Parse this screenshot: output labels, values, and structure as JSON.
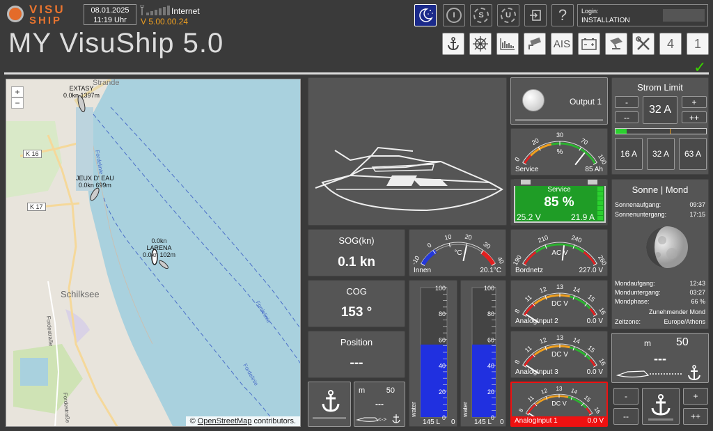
{
  "header": {
    "logo_top": "VISU",
    "logo_bottom": "SHIP",
    "date": "08.01.2025",
    "time": "11:19 Uhr",
    "network_label": "Internet",
    "version": "V 5.00.00.24",
    "title": "MY VisuShip 5.0",
    "login_label": "Login:",
    "login_value": "INSTALLATION"
  },
  "toolbar_top": [
    {
      "name": "night-mode-button",
      "icon": "moon-icon"
    },
    {
      "name": "info-button",
      "label": "I"
    },
    {
      "name": "settings-s-button",
      "label": "S"
    },
    {
      "name": "user-button",
      "label": "U"
    },
    {
      "name": "logout-button",
      "icon": "exit-icon"
    },
    {
      "name": "help-button",
      "label": "?"
    }
  ],
  "toolbar_bottom": [
    {
      "name": "anchor-tab",
      "icon": "anchor-icon"
    },
    {
      "name": "helm-tab",
      "icon": "helm-icon"
    },
    {
      "name": "chart-tab",
      "icon": "chart-icon"
    },
    {
      "name": "camera-tab",
      "icon": "camera-icon"
    },
    {
      "name": "ais-tab",
      "label": "AIS"
    },
    {
      "name": "battery-tab",
      "icon": "battery-icon"
    },
    {
      "name": "satellite-tab",
      "icon": "satellite-icon"
    },
    {
      "name": "tools-tab",
      "icon": "tools-icon"
    },
    {
      "name": "page-4-tab",
      "label": "4"
    },
    {
      "name": "page-1-tab",
      "label": "1"
    }
  ],
  "map": {
    "credit_prefix": "©",
    "credit_link": "OpenStreetMap",
    "credit_suffix": "contributors.",
    "zoom_in": "+",
    "zoom_out": "−",
    "labels": {
      "strande": "Strande",
      "schilksee": "Schilksee",
      "k16": "K 16",
      "k17": "K 17",
      "fordelinie1": "Fordelinie",
      "fordelinie2": "Fordelinie",
      "fordelinie3": "Fordelinie",
      "fordestrasse": "Fordestraße",
      "fordestrasse2": "Fordestraße"
    },
    "ships": [
      {
        "name": "EXTASY",
        "info": "0.0kn 1397m"
      },
      {
        "name": "JEUX D' EAU",
        "info": "0.0kn 699m"
      },
      {
        "name": "LARENA",
        "info_top": "0.0kn",
        "info": "0.0kn 102m"
      }
    ]
  },
  "nav": {
    "sog_label": "SOG(kn)",
    "sog_value": "0.1 kn",
    "cog_label": "COG",
    "cog_value": "153 °",
    "pos_label": "Position",
    "pos_value": "---"
  },
  "anchor_small": {
    "unit": "m",
    "value": "50",
    "dash": "---"
  },
  "temp_gauge": {
    "ticks": [
      "-10",
      "0",
      "10",
      "20",
      "30",
      "40"
    ],
    "unit": "°C",
    "label": "Innen",
    "value": "20.1°C"
  },
  "tanks": [
    {
      "ticks": [
        "100",
        "80",
        "60",
        "40",
        "20",
        "0"
      ],
      "name": "water",
      "value": "145 L",
      "fill": 0.56
    },
    {
      "ticks": [
        "100",
        "80",
        "60",
        "40",
        "20",
        "0"
      ],
      "name": "water",
      "value": "145 L",
      "fill": 0.56
    }
  ],
  "output": {
    "label": "Output 1"
  },
  "service_gauge": {
    "ticks": [
      "0",
      "20",
      "30",
      "70",
      "100"
    ],
    "unit": "%",
    "label": "Service",
    "value": "85 Ah"
  },
  "service_battery": {
    "label": "Service",
    "percent": "85 %",
    "voltage": "25.2 V",
    "current": "21.9 A"
  },
  "bordnetz": {
    "ticks": [
      "190",
      "210",
      "240",
      "260"
    ],
    "unit": "AC V",
    "label": "Bordnetz",
    "value": "227.0 V"
  },
  "dc_gauges": [
    {
      "ticks": [
        "8",
        "11",
        "12",
        "13",
        "14",
        "15",
        "16"
      ],
      "unit": "DC  V",
      "label": "AnalogInput 2",
      "value": "0.0 V",
      "alarm": false
    },
    {
      "ticks": [
        "8",
        "11",
        "12",
        "13",
        "14",
        "15",
        "16"
      ],
      "unit": "DC  V",
      "label": "AnalogInput 3",
      "value": "0.0 V",
      "alarm": false
    },
    {
      "ticks": [
        "8",
        "11",
        "12",
        "13",
        "14",
        "15",
        "16"
      ],
      "unit": "DC  V",
      "label": "AnalogInput 1",
      "value": "0.0 V",
      "alarm": true
    }
  ],
  "strom": {
    "title": "Strom Limit",
    "minus": "-",
    "minusminus": "--",
    "plus": "+",
    "plusplus": "++",
    "value": "32 A",
    "bar_fill": 0.12,
    "presets": [
      "16 A",
      "32 A",
      "63 A"
    ]
  },
  "sun": {
    "title": "Sonne | Mond",
    "rows_top": [
      {
        "k": "Sonnenaufgang:",
        "v": "09:37"
      },
      {
        "k": "Sonnenuntergang:",
        "v": "17:15"
      }
    ],
    "rows_bottom": [
      {
        "k": "Mondaufgang:",
        "v": "12:43"
      },
      {
        "k": "Monduntergang:",
        "v": "03:27"
      },
      {
        "k": "Mondphase:",
        "v": "66 %"
      }
    ],
    "phase_name": "Zunehmender Mond",
    "tz_label": "Zeitzone:",
    "tz_value": "Europe/Athens"
  },
  "anchor_big": {
    "unit": "m",
    "value": "50",
    "dash": "---",
    "minus": "-",
    "minusminus": "--",
    "plus": "+",
    "plusplus": "++"
  }
}
